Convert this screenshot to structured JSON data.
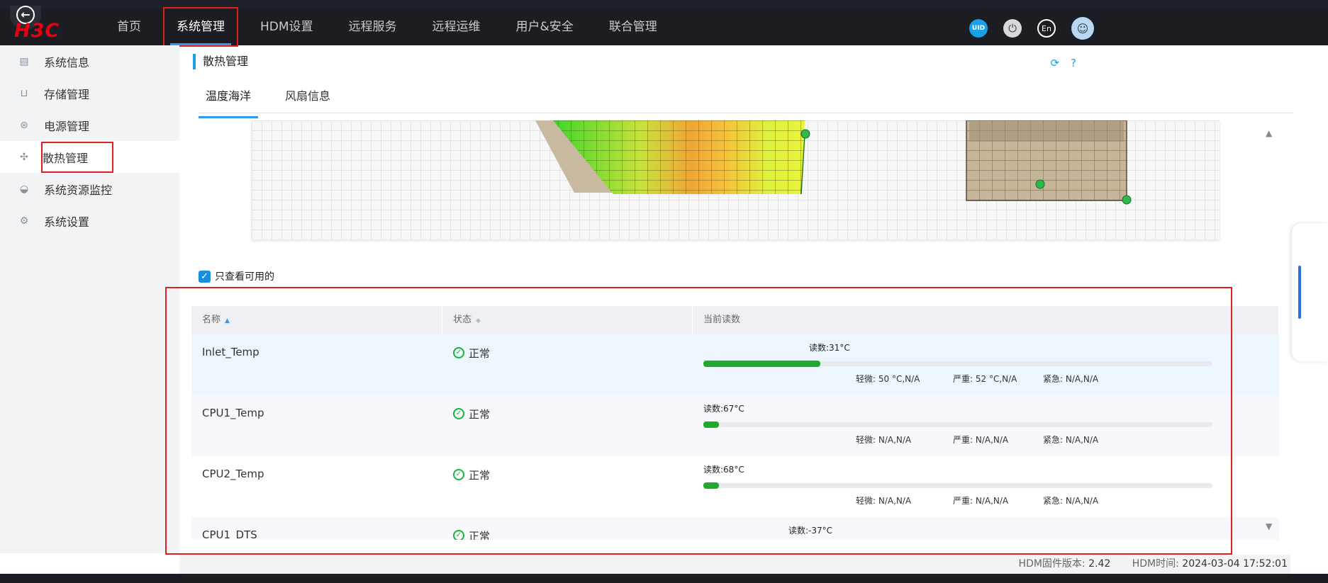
{
  "header": {
    "logo": "H3C",
    "nav": [
      {
        "label": "首页"
      },
      {
        "label": "系统管理"
      },
      {
        "label": "HDM设置"
      },
      {
        "label": "远程服务"
      },
      {
        "label": "远程运维"
      },
      {
        "label": "用户&安全"
      },
      {
        "label": "联合管理"
      }
    ],
    "active_nav": "系统管理",
    "uid_label": "UID",
    "lang_label": "En"
  },
  "sidebar": {
    "items": [
      {
        "label": "系统信息",
        "icon": "doc-icon"
      },
      {
        "label": "存储管理",
        "icon": "storage-icon"
      },
      {
        "label": "电源管理",
        "icon": "power-icon"
      },
      {
        "label": "散热管理",
        "icon": "fan-icon"
      },
      {
        "label": "系统资源监控",
        "icon": "gauge-icon"
      },
      {
        "label": "系统设置",
        "icon": "gear-icon"
      }
    ],
    "active": "散热管理"
  },
  "content": {
    "title": "散热管理",
    "tabs": [
      {
        "label": "温度海洋"
      },
      {
        "label": "风扇信息"
      }
    ],
    "active_tab": "温度海洋",
    "checkbox_label": "只查看可用的",
    "checkbox_checked": true
  },
  "table": {
    "columns": [
      "名称",
      "状态",
      "当前读数"
    ],
    "rows": [
      {
        "name": "Inlet_Temp",
        "status": "正常",
        "reading": "读数:31°C",
        "level": 0.23,
        "minor": "轻微: 50 °C,N/A",
        "major": "严重: 52 °C,N/A",
        "critical": "紧急: N/A,N/A"
      },
      {
        "name": "CPU1_Temp",
        "status": "正常",
        "reading": "读数:67°C",
        "level": 0.03,
        "minor": "轻微: N/A,N/A",
        "major": "严重: N/A,N/A",
        "critical": "紧急: N/A,N/A"
      },
      {
        "name": "CPU2_Temp",
        "status": "正常",
        "reading": "读数:68°C",
        "level": 0.03,
        "minor": "轻微: N/A,N/A",
        "major": "严重: N/A,N/A",
        "critical": "紧急: N/A,N/A"
      },
      {
        "name": "CPU1_DTS",
        "status": "正常",
        "reading": "读数:-37°C"
      }
    ]
  },
  "footer": {
    "version_label": "HDM固件版本:",
    "version_value": "2.42",
    "time_label": "HDM时间:",
    "time_value": "2024-03-04 17:52:01"
  }
}
